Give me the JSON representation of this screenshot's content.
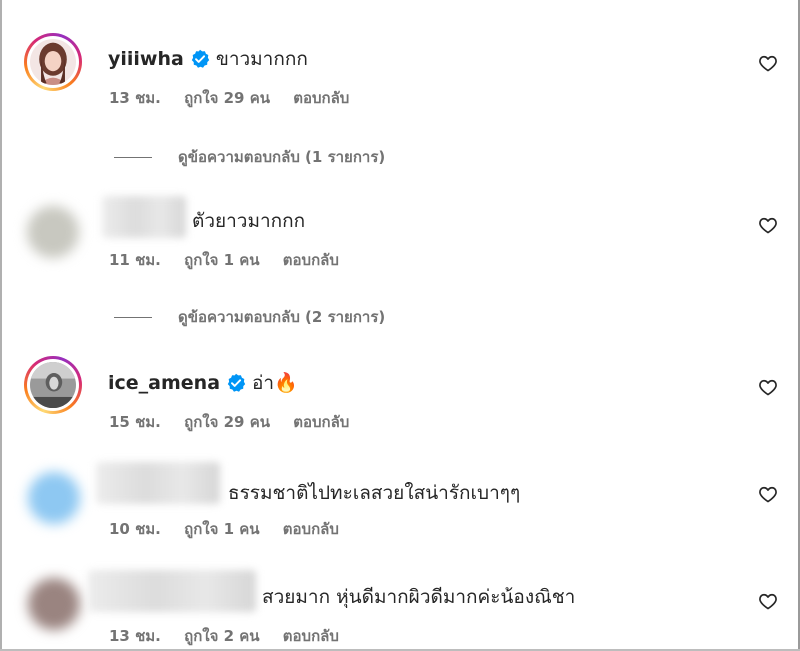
{
  "comments": [
    {
      "username": "yiiiwha",
      "verified": true,
      "text": "ขาวมากกก",
      "time": "13 ชม.",
      "likes": "ถูกใจ 29 คน",
      "reply": "ตอบกลับ",
      "view_replies": "ดูข้อความตอบกลับ (1 รายการ)"
    },
    {
      "username": "",
      "verified": false,
      "text": "ตัวยาวมากกก",
      "time": "11 ชม.",
      "likes": "ถูกใจ 1 คน",
      "reply": "ตอบกลับ",
      "view_replies": "ดูข้อความตอบกลับ (2 รายการ)"
    },
    {
      "username": "ice_amena",
      "verified": true,
      "text": "อ่า🔥",
      "time": "15 ชม.",
      "likes": "ถูกใจ 29 คน",
      "reply": "ตอบกลับ"
    },
    {
      "username": "",
      "verified": false,
      "text": "ธรรมชาติไปทะเลสวยใสน่ารักเบาๆๆ",
      "time": "10 ชม.",
      "likes": "ถูกใจ 1 คน",
      "reply": "ตอบกลับ"
    },
    {
      "username": "",
      "verified": false,
      "text": "สวยมาก หุ่นดีมากผิวดีมากค่ะน้องณิชา",
      "time": "13 ชม.",
      "likes": "ถูกใจ 2 คน",
      "reply": "ตอบกลับ"
    }
  ],
  "icons": {
    "verified": "verified-badge-icon",
    "like": "heart-icon"
  },
  "colors": {
    "verified_blue": "#0095f6",
    "meta_gray": "#737373",
    "text": "#262626"
  }
}
